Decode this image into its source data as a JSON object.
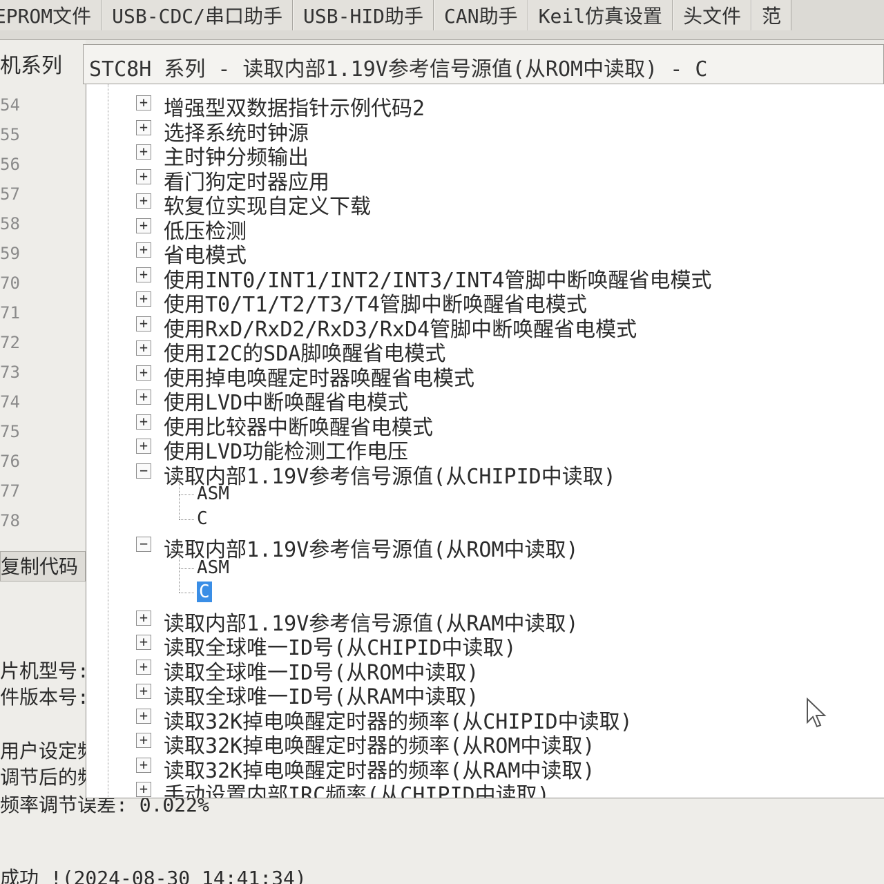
{
  "tabs": [
    "EEPROM文件",
    "USB-CDC/串口助手",
    "USB-HID助手",
    "CAN助手",
    "Keil仿真设置",
    "头文件",
    "范"
  ],
  "left": {
    "series_label": "机系列",
    "line_numbers": [
      "54",
      "55",
      "56",
      "57",
      "58",
      "59",
      "70",
      "71",
      "72",
      "73",
      "74",
      "75",
      "76",
      "77",
      "78"
    ],
    "copy_code_button": "复制代码",
    "info_lines": [
      "片机型号:",
      "件版本号:",
      "用户设定频",
      "调节后的频",
      "频率调节误差: 0.022%",
      "成功 !(2024-08-30 14:41:34)"
    ]
  },
  "combo": {
    "value": "STC8H 系列 - 读取内部1.19V参考信号源值(从ROM中读取) - C"
  },
  "tree": {
    "nodes": [
      {
        "label": "增强型双数据指针示例代码2",
        "expanded": false
      },
      {
        "label": "选择系统时钟源",
        "expanded": false
      },
      {
        "label": "主时钟分频输出",
        "expanded": false
      },
      {
        "label": "看门狗定时器应用",
        "expanded": false
      },
      {
        "label": "软复位实现自定义下载",
        "expanded": false
      },
      {
        "label": "低压检测",
        "expanded": false
      },
      {
        "label": "省电模式",
        "expanded": false
      },
      {
        "label": "使用INT0/INT1/INT2/INT3/INT4管脚中断唤醒省电模式",
        "expanded": false
      },
      {
        "label": "使用T0/T1/T2/T3/T4管脚中断唤醒省电模式",
        "expanded": false
      },
      {
        "label": "使用RxD/RxD2/RxD3/RxD4管脚中断唤醒省电模式",
        "expanded": false
      },
      {
        "label": "使用I2C的SDA脚唤醒省电模式",
        "expanded": false
      },
      {
        "label": "使用掉电唤醒定时器唤醒省电模式",
        "expanded": false
      },
      {
        "label": "使用LVD中断唤醒省电模式",
        "expanded": false
      },
      {
        "label": "使用比较器中断唤醒省电模式",
        "expanded": false
      },
      {
        "label": "使用LVD功能检测工作电压",
        "expanded": false
      },
      {
        "label": "读取内部1.19V参考信号源值(从CHIPID中读取)",
        "expanded": true,
        "children": [
          "ASM",
          "C"
        ]
      },
      {
        "label": "读取内部1.19V参考信号源值(从ROM中读取)",
        "expanded": true,
        "children": [
          "ASM",
          "C"
        ],
        "selected_child": 1
      },
      {
        "label": "读取内部1.19V参考信号源值(从RAM中读取)",
        "expanded": false
      },
      {
        "label": "读取全球唯一ID号(从CHIPID中读取)",
        "expanded": false
      },
      {
        "label": "读取全球唯一ID号(从ROM中读取)",
        "expanded": false
      },
      {
        "label": "读取全球唯一ID号(从RAM中读取)",
        "expanded": false
      },
      {
        "label": "读取32K掉电唤醒定时器的频率(从CHIPID中读取)",
        "expanded": false
      },
      {
        "label": "读取32K掉电唤醒定时器的频率(从ROM中读取)",
        "expanded": false
      },
      {
        "label": "读取32K掉电唤醒定时器的频率(从RAM中读取)",
        "expanded": false
      },
      {
        "label": "手动设置内部IRC频率(从CHIPID中读取)",
        "expanded": false
      }
    ],
    "collapsed_glyph": "+",
    "expanded_glyph": "−"
  },
  "icons": {
    "cursor": "mouse-pointer-icon"
  },
  "colors": {
    "selection": "#3a8ee6",
    "tree_bg": "#ffffff",
    "window_bg": "#e9e8e4"
  }
}
